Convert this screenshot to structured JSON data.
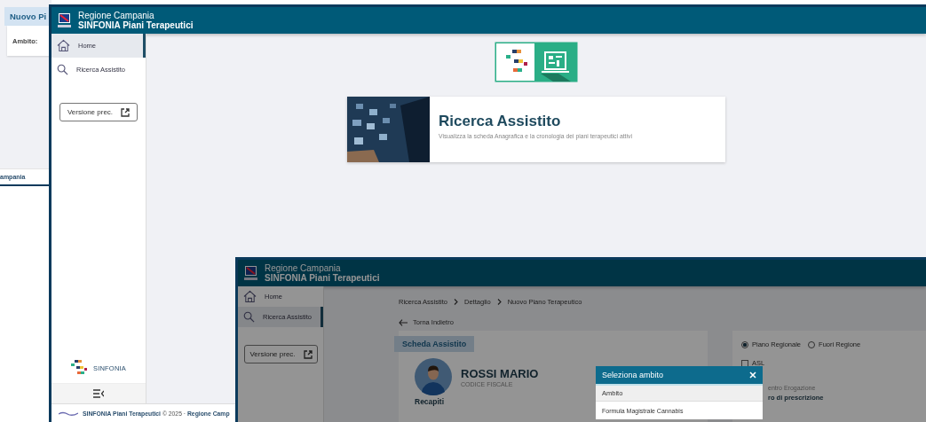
{
  "back_window": {
    "tab": "Nuovo Pi",
    "field_label": "Ambito:",
    "footer": "ampania"
  },
  "home_window": {
    "header": {
      "region": "Regione Campania",
      "app": "SINFONIA Piani Terapeutici"
    },
    "sidebar": {
      "items": [
        {
          "label": "Home",
          "selected": true
        },
        {
          "label": "Ricerca Assistito",
          "selected": false
        }
      ],
      "button": "Versione prec.",
      "brand": "SINFONIA"
    },
    "card": {
      "title": "Ricerca Assistito",
      "description": "Visualizza la scheda Anagrafica e la cronologia dei piani terapeutici attivi"
    },
    "footer": "**SINFONIA Piani Terapeutici** © 2025 · **Regione Camp**"
  },
  "detail_window": {
    "header": {
      "region": "Regione Campania",
      "app": "SINFONIA Piani Terapeutici"
    },
    "sidebar": {
      "items": [
        {
          "label": "Home",
          "selected": false
        },
        {
          "label": "Ricerca Assistito",
          "selected": true
        }
      ],
      "button": "Versione prec."
    },
    "breadcrumb": [
      "Ricerca Assistito",
      "Dettaglio",
      "Nuovo Piano Terapeutico"
    ],
    "back_link": "Torna Indietro",
    "tab": "Scheda Assistito",
    "patient": {
      "name": "ROSSI MARIO",
      "code_label": "CODICE FISCALE",
      "section": "Recapiti"
    },
    "plan_types": [
      {
        "label": "Piano Regionale",
        "selected": true
      },
      {
        "label": "Fuori Regione",
        "selected": false
      }
    ],
    "asl": {
      "label": "ASL",
      "checked": false
    },
    "centre_label": "entro Erogazione",
    "centre_value": "ro di prescrizione",
    "dialog": {
      "title": "Seleziona ambito",
      "column": "Ambito",
      "rows": [
        "Formula Magistrale Cannabis"
      ]
    }
  }
}
